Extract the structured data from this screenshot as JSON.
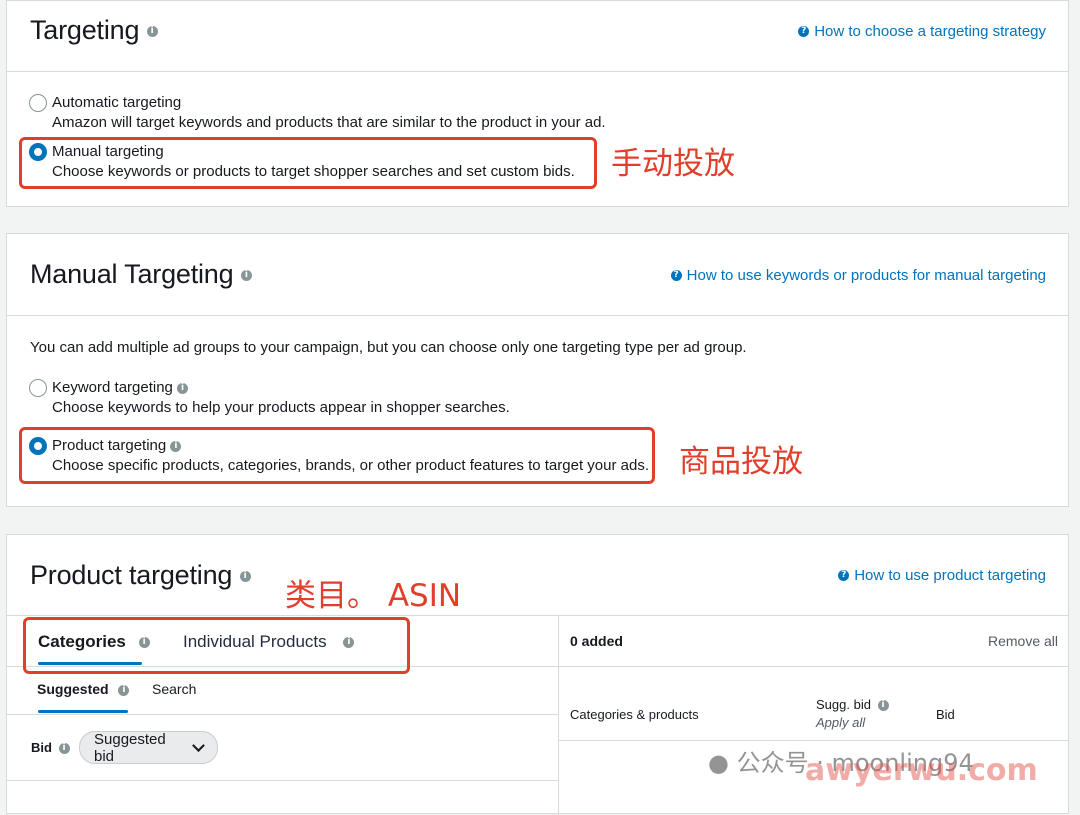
{
  "targeting": {
    "title": "Targeting",
    "help_link": "How to choose a targeting strategy",
    "options": [
      {
        "label": "Automatic targeting",
        "desc": "Amazon will target keywords and products that are similar to the product in your ad."
      },
      {
        "label": "Manual targeting",
        "desc": "Choose keywords or products to target shopper searches and set custom bids."
      }
    ],
    "annotation": "手动投放"
  },
  "manual": {
    "title": "Manual Targeting",
    "help_link": "How to use keywords or products for manual targeting",
    "intro": "You can add multiple ad groups to your campaign, but you can choose only one targeting type per ad group.",
    "options": [
      {
        "label": "Keyword targeting",
        "desc": "Choose keywords to help your products appear in shopper searches."
      },
      {
        "label": "Product targeting",
        "desc": "Choose specific products, categories, brands, or other product features to target your ads."
      }
    ],
    "annotation": "商品投放"
  },
  "product": {
    "title": "Product targeting",
    "help_link": "How to use product targeting",
    "annotation": "类目。 ASIN",
    "tabs": [
      "Categories",
      "Individual Products"
    ],
    "subtabs": [
      "Suggested",
      "Search"
    ],
    "bid_label": "Bid",
    "bid_button": "Suggested bid",
    "added": "0 added",
    "remove_all": "Remove all",
    "col_categories": "Categories & products",
    "col_sugg": "Sugg. bid",
    "apply_all": "Apply all",
    "col_bid": "Bid"
  },
  "watermark": {
    "text": "公众号 · moonling94",
    "site": "awyerwu.com"
  },
  "colors": {
    "accent": "#0073bb",
    "annotation_red": "#e0402b"
  }
}
